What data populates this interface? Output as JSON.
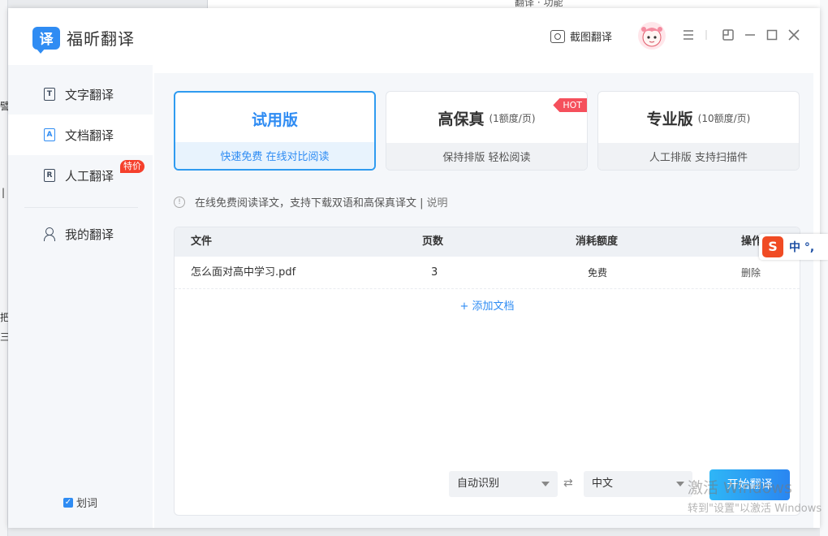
{
  "background": {
    "top_fragment": "翻译 · 功能",
    "left_fragments": [
      "譬",
      "|",
      "把",
      "三"
    ]
  },
  "app": {
    "logo_glyph": "译",
    "name": "福昕翻译",
    "accent_color": "#2f8cf3"
  },
  "titlebar": {
    "screenshot_translate": "截图翻译",
    "icons": [
      "camera-icon",
      "avatar",
      "menu-icon",
      "pin-icon",
      "minimize-icon",
      "maximize-icon",
      "close-icon"
    ]
  },
  "sidebar": {
    "items": [
      {
        "label": "文字翻译",
        "icon": "T"
      },
      {
        "label": "文档翻译",
        "icon": "A"
      },
      {
        "label": "人工翻译",
        "icon": "R",
        "badge": "特价"
      },
      {
        "label": "我的翻译"
      }
    ],
    "huaci_label": "划词",
    "huaci_checked": true
  },
  "plans": [
    {
      "title": "试用版",
      "quota": "",
      "subtitle": "快速免费 在线对比阅读",
      "active": true
    },
    {
      "title": "高保真",
      "quota": "(1额度/页)",
      "subtitle": "保持排版 轻松阅读",
      "badge": "HOT"
    },
    {
      "title": "专业版",
      "quota": "(10额度/页)",
      "subtitle": "人工排版 支持扫描件"
    }
  ],
  "info": {
    "text": "在线免费阅读译文，支持下载双语和高保真译文 |",
    "link": "说明"
  },
  "table": {
    "headers": [
      "文件",
      "页数",
      "消耗额度",
      "操作"
    ],
    "rows": [
      {
        "file": "怎么面对高中学习.pdf",
        "pages": "3",
        "quota": "免费",
        "action": "删除"
      }
    ],
    "add_doc": "+ 添加文档"
  },
  "translate": {
    "source_lang": "自动识别",
    "swap_symbol": "⇄",
    "target_lang": "中文",
    "start_label": "开始翻译"
  },
  "ime": {
    "logo": "S",
    "text": "中 °,"
  },
  "watermark": {
    "line1": "激活 Windows",
    "line2": "转到\"设置\"以激活 Windows"
  }
}
